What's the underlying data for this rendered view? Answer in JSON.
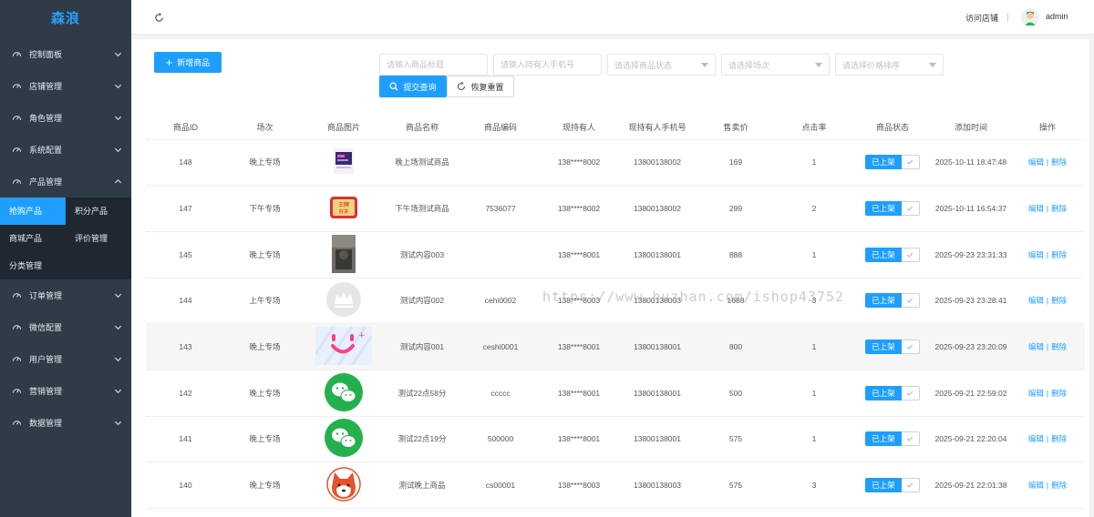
{
  "brand": "森浪",
  "sidebar": {
    "items_top": [
      {
        "label": "控制面板",
        "icon": "dashboard-icon"
      },
      {
        "label": "店铺管理",
        "icon": "dashboard-icon"
      },
      {
        "label": "角色管理",
        "icon": "dashboard-icon"
      },
      {
        "label": "系统配置",
        "icon": "dashboard-icon"
      },
      {
        "label": "产品管理",
        "icon": "dashboard-icon",
        "expanded": true
      }
    ],
    "sub_items": [
      {
        "label": "抢购产品",
        "active": true
      },
      {
        "label": "积分产品"
      },
      {
        "label": "商城产品"
      },
      {
        "label": "评价管理"
      },
      {
        "label": "分类管理"
      }
    ],
    "items_bottom": [
      {
        "label": "订单管理",
        "icon": "dashboard-icon"
      },
      {
        "label": "微信配置",
        "icon": "dashboard-icon"
      },
      {
        "label": "用户管理",
        "icon": "dashboard-icon"
      },
      {
        "label": "营销管理",
        "icon": "dashboard-icon"
      },
      {
        "label": "数据管理",
        "icon": "dashboard-icon"
      }
    ]
  },
  "topbar": {
    "visit_store": "访问店铺",
    "username": "admin"
  },
  "toolbar": {
    "add_label": "新增商品",
    "title_placeholder": "请输入商品标题",
    "phone_placeholder": "请输入持有人手机号",
    "status_placeholder": "请选择商品状态",
    "session_placeholder": "请选择场次",
    "price_placeholder": "请选择价格排序",
    "query_label": "提交查询",
    "reset_label": "恢复重置"
  },
  "table": {
    "headers": [
      "商品ID",
      "场次",
      "商品图片",
      "商品名称",
      "商品编码",
      "现持有人",
      "现持有人手机号",
      "售卖价",
      "点击率",
      "商品状态",
      "添加时间",
      "操作"
    ],
    "status_label": "已上架",
    "edit_label": "编辑",
    "delete_label": "删除",
    "rows": [
      {
        "id": "148",
        "session": "晚上专场",
        "image": "purple-card",
        "name": "晚上场测试商品",
        "code": "",
        "holder": "138****8002",
        "phone": "13800138002",
        "price": "169",
        "clicks": "1",
        "time": "2025-10-11 18:47:48"
      },
      {
        "id": "147",
        "session": "下午专场",
        "image": "red-badge",
        "name": "下午场测试商品",
        "code": "7536077",
        "holder": "138****8002",
        "phone": "13800138002",
        "price": "299",
        "clicks": "2",
        "time": "2025-10-11 16:54:37"
      },
      {
        "id": "145",
        "session": "晚上专场",
        "image": "dark-photo",
        "name": "测试内容003",
        "code": "",
        "holder": "138****8001",
        "phone": "13800138001",
        "price": "888",
        "clicks": "1",
        "time": "2025-09-23 23:31:33"
      },
      {
        "id": "144",
        "session": "上午专场",
        "image": "crown-logo",
        "name": "测试内容002",
        "code": "cehi0002",
        "holder": "138****8003",
        "phone": "13800138003",
        "price": "1688",
        "clicks": "3",
        "time": "2025-09-23 23:28:41"
      },
      {
        "id": "143",
        "session": "晚上专场",
        "image": "smile-banner",
        "name": "测试内容001",
        "code": "ceshi0001",
        "holder": "138****8001",
        "phone": "13800138001",
        "price": "800",
        "clicks": "1",
        "time": "2025-09-23 23:20:09"
      },
      {
        "id": "142",
        "session": "晚上专场",
        "image": "wechat-logo",
        "name": "测试22点58分",
        "code": "ccccc",
        "holder": "138****8001",
        "phone": "13800138001",
        "price": "500",
        "clicks": "1",
        "time": "2025-09-21 22:59:02"
      },
      {
        "id": "141",
        "session": "晚上专场",
        "image": "wechat-logo",
        "name": "测试22点19分",
        "code": "500000",
        "holder": "138****8001",
        "phone": "13800138001",
        "price": "575",
        "clicks": "1",
        "time": "2025-09-21 22:20:04"
      },
      {
        "id": "140",
        "session": "晚上专场",
        "image": "shiba-logo",
        "name": "测试晚上商品",
        "code": "cs00001",
        "holder": "138****8003",
        "phone": "13800138003",
        "price": "575",
        "clicks": "3",
        "time": "2025-09-21 22:01:38"
      }
    ]
  },
  "watermark": "https://www.huzhan.com/ishop43752",
  "colors": {
    "accent": "#1e9fff",
    "sidebar_bg": "#2f3b47",
    "sidebar_sub_bg": "#1f2831",
    "brand": "#27a1ff"
  }
}
